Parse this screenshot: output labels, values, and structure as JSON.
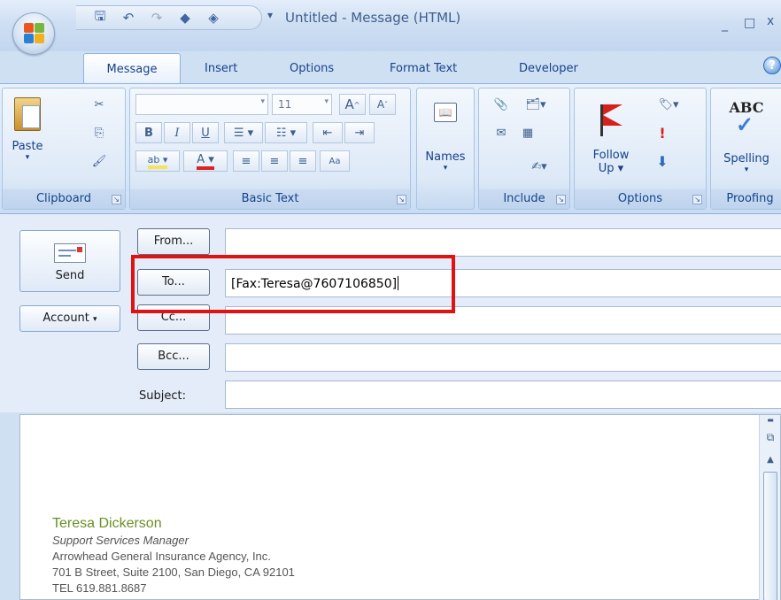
{
  "window": {
    "title": "Untitled - Message (HTML)",
    "minimize": "_",
    "maximize": "□",
    "close": "x"
  },
  "tabs": [
    {
      "label": "Message"
    },
    {
      "label": "Insert"
    },
    {
      "label": "Options"
    },
    {
      "label": "Format Text"
    },
    {
      "label": "Developer"
    }
  ],
  "help": "?",
  "ribbon": {
    "clipboard": {
      "label": "Clipboard",
      "paste": "Paste"
    },
    "basic_text": {
      "label": "Basic Text",
      "font_size": "11",
      "bold": "B",
      "italic": "I",
      "underline": "U"
    },
    "names": {
      "label": "Names"
    },
    "include": {
      "label": "Include"
    },
    "options": {
      "label": "Options",
      "follow_up": "Follow",
      "follow_up2": "Up"
    },
    "proofing": {
      "label": "Proofing",
      "spelling": "Spelling",
      "abc": "ABC"
    }
  },
  "header": {
    "send": "Send",
    "account": "Account",
    "from_btn": "From...",
    "to_btn": "To...",
    "cc_btn": "Cc...",
    "bcc_btn": "Bcc...",
    "subject_label": "Subject:",
    "from_value": "",
    "to_value": "[Fax:Teresa@7607106850]",
    "cc_value": "",
    "bcc_value": "",
    "subject_value": ""
  },
  "body": {
    "signature": {
      "name": "Teresa Dickerson",
      "title": "Support Services Manager",
      "company": "Arrowhead General Insurance Agency, Inc.",
      "address": "701 B Street, Suite 2100, San Diego, CA 92101",
      "phone": "TEL 619.881.8687"
    }
  },
  "colors": {
    "highlight": "#e01212",
    "signature_name": "#6a8f24"
  }
}
